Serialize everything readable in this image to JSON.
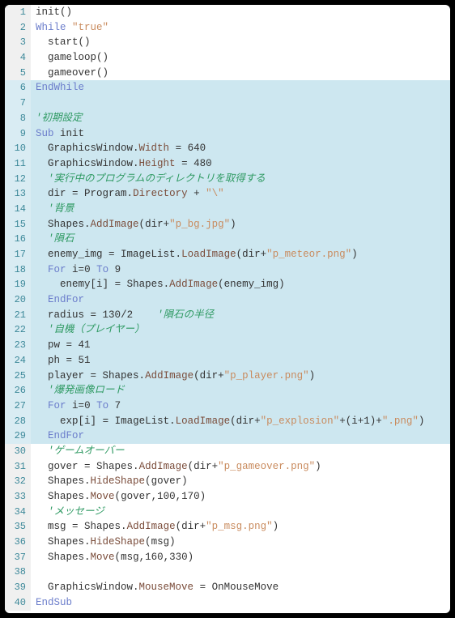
{
  "editor": {
    "colors": {
      "background": "#ffffff",
      "selection": "#cde7f0",
      "gutter_bg": "#f0f0f0",
      "gutter_fg": "#3c8899",
      "keyword": "#6b7dcb",
      "string": "#c98b5e",
      "comment": "#2f9a63",
      "member": "#7a4c3a",
      "default": "#333333"
    },
    "selection_range": [
      6,
      29
    ],
    "lines": [
      {
        "n": 1,
        "tokens": [
          [
            "ident",
            "init"
          ],
          [
            "punct",
            "()"
          ]
        ]
      },
      {
        "n": 2,
        "tokens": [
          [
            "keyword",
            "While"
          ],
          [
            "ident",
            " "
          ],
          [
            "string",
            "\"true\""
          ]
        ]
      },
      {
        "n": 3,
        "tokens": [
          [
            "ident",
            "  start"
          ],
          [
            "punct",
            "()"
          ]
        ]
      },
      {
        "n": 4,
        "tokens": [
          [
            "ident",
            "  gameloop"
          ],
          [
            "punct",
            "()"
          ]
        ]
      },
      {
        "n": 5,
        "tokens": [
          [
            "ident",
            "  gameover"
          ],
          [
            "punct",
            "()"
          ]
        ]
      },
      {
        "n": 6,
        "tokens": [
          [
            "keyword",
            "EndWhile"
          ]
        ]
      },
      {
        "n": 7,
        "tokens": []
      },
      {
        "n": 8,
        "tokens": [
          [
            "comment",
            "'初期設定"
          ]
        ]
      },
      {
        "n": 9,
        "tokens": [
          [
            "keyword",
            "Sub"
          ],
          [
            "ident",
            " init"
          ]
        ]
      },
      {
        "n": 10,
        "tokens": [
          [
            "ident",
            "  GraphicsWindow"
          ],
          [
            "punct",
            "."
          ],
          [
            "member",
            "Width"
          ],
          [
            "op",
            " = "
          ],
          [
            "number",
            "640"
          ]
        ]
      },
      {
        "n": 11,
        "tokens": [
          [
            "ident",
            "  GraphicsWindow"
          ],
          [
            "punct",
            "."
          ],
          [
            "member",
            "Height"
          ],
          [
            "op",
            " = "
          ],
          [
            "number",
            "480"
          ]
        ]
      },
      {
        "n": 12,
        "tokens": [
          [
            "ident",
            "  "
          ],
          [
            "comment",
            "'実行中のプログラムのディレクトリを取得する"
          ]
        ]
      },
      {
        "n": 13,
        "tokens": [
          [
            "ident",
            "  dir "
          ],
          [
            "op",
            "="
          ],
          [
            "ident",
            " Program"
          ],
          [
            "punct",
            "."
          ],
          [
            "member",
            "Directory"
          ],
          [
            "op",
            " + "
          ],
          [
            "string",
            "\"\\\""
          ]
        ]
      },
      {
        "n": 14,
        "tokens": [
          [
            "ident",
            "  "
          ],
          [
            "comment",
            "'背景"
          ]
        ]
      },
      {
        "n": 15,
        "tokens": [
          [
            "ident",
            "  Shapes"
          ],
          [
            "punct",
            "."
          ],
          [
            "member",
            "AddImage"
          ],
          [
            "punct",
            "("
          ],
          [
            "ident",
            "dir"
          ],
          [
            "op",
            "+"
          ],
          [
            "string",
            "\"p_bg.jpg\""
          ],
          [
            "punct",
            ")"
          ]
        ]
      },
      {
        "n": 16,
        "tokens": [
          [
            "ident",
            "  "
          ],
          [
            "comment",
            "'隕石"
          ]
        ]
      },
      {
        "n": 17,
        "tokens": [
          [
            "ident",
            "  enemy_img "
          ],
          [
            "op",
            "="
          ],
          [
            "ident",
            " ImageList"
          ],
          [
            "punct",
            "."
          ],
          [
            "member",
            "LoadImage"
          ],
          [
            "punct",
            "("
          ],
          [
            "ident",
            "dir"
          ],
          [
            "op",
            "+"
          ],
          [
            "string",
            "\"p_meteor.png\""
          ],
          [
            "punct",
            ")"
          ]
        ]
      },
      {
        "n": 18,
        "tokens": [
          [
            "ident",
            "  "
          ],
          [
            "keyword",
            "For"
          ],
          [
            "ident",
            " i"
          ],
          [
            "op",
            "="
          ],
          [
            "number",
            "0"
          ],
          [
            "ident",
            " "
          ],
          [
            "keyword",
            "To"
          ],
          [
            "ident",
            " "
          ],
          [
            "number",
            "9"
          ]
        ]
      },
      {
        "n": 19,
        "tokens": [
          [
            "ident",
            "    enemy"
          ],
          [
            "punct",
            "["
          ],
          [
            "ident",
            "i"
          ],
          [
            "punct",
            "]"
          ],
          [
            "op",
            " = "
          ],
          [
            "ident",
            "Shapes"
          ],
          [
            "punct",
            "."
          ],
          [
            "member",
            "AddImage"
          ],
          [
            "punct",
            "("
          ],
          [
            "ident",
            "enemy_img"
          ],
          [
            "punct",
            ")"
          ]
        ]
      },
      {
        "n": 20,
        "tokens": [
          [
            "ident",
            "  "
          ],
          [
            "keyword",
            "EndFor"
          ]
        ]
      },
      {
        "n": 21,
        "tokens": [
          [
            "ident",
            "  radius "
          ],
          [
            "op",
            "="
          ],
          [
            "ident",
            " "
          ],
          [
            "number",
            "130"
          ],
          [
            "op",
            "/"
          ],
          [
            "number",
            "2"
          ],
          [
            "ident",
            "    "
          ],
          [
            "comment",
            "'隕石の半径"
          ]
        ]
      },
      {
        "n": 22,
        "tokens": [
          [
            "ident",
            "  "
          ],
          [
            "comment",
            "'自機（プレイヤー）"
          ]
        ]
      },
      {
        "n": 23,
        "tokens": [
          [
            "ident",
            "  pw "
          ],
          [
            "op",
            "="
          ],
          [
            "ident",
            " "
          ],
          [
            "number",
            "41"
          ]
        ]
      },
      {
        "n": 24,
        "tokens": [
          [
            "ident",
            "  ph "
          ],
          [
            "op",
            "="
          ],
          [
            "ident",
            " "
          ],
          [
            "number",
            "51"
          ]
        ]
      },
      {
        "n": 25,
        "tokens": [
          [
            "ident",
            "  player "
          ],
          [
            "op",
            "="
          ],
          [
            "ident",
            " Shapes"
          ],
          [
            "punct",
            "."
          ],
          [
            "member",
            "AddImage"
          ],
          [
            "punct",
            "("
          ],
          [
            "ident",
            "dir"
          ],
          [
            "op",
            "+"
          ],
          [
            "string",
            "\"p_player.png\""
          ],
          [
            "punct",
            ")"
          ]
        ]
      },
      {
        "n": 26,
        "tokens": [
          [
            "ident",
            "  "
          ],
          [
            "comment",
            "'爆発画像ロード"
          ]
        ]
      },
      {
        "n": 27,
        "tokens": [
          [
            "ident",
            "  "
          ],
          [
            "keyword",
            "For"
          ],
          [
            "ident",
            " i"
          ],
          [
            "op",
            "="
          ],
          [
            "number",
            "0"
          ],
          [
            "ident",
            " "
          ],
          [
            "keyword",
            "To"
          ],
          [
            "ident",
            " "
          ],
          [
            "number",
            "7"
          ]
        ]
      },
      {
        "n": 28,
        "tokens": [
          [
            "ident",
            "    exp"
          ],
          [
            "punct",
            "["
          ],
          [
            "ident",
            "i"
          ],
          [
            "punct",
            "]"
          ],
          [
            "op",
            " = "
          ],
          [
            "ident",
            "ImageList"
          ],
          [
            "punct",
            "."
          ],
          [
            "member",
            "LoadImage"
          ],
          [
            "punct",
            "("
          ],
          [
            "ident",
            "dir"
          ],
          [
            "op",
            "+"
          ],
          [
            "string",
            "\"p_explosion\""
          ],
          [
            "op",
            "+"
          ],
          [
            "punct",
            "("
          ],
          [
            "ident",
            "i"
          ],
          [
            "op",
            "+"
          ],
          [
            "number",
            "1"
          ],
          [
            "punct",
            ")"
          ],
          [
            "op",
            "+"
          ],
          [
            "string",
            "\".png\""
          ],
          [
            "punct",
            ")"
          ]
        ]
      },
      {
        "n": 29,
        "tokens": [
          [
            "ident",
            "  "
          ],
          [
            "keyword",
            "EndFor"
          ]
        ]
      },
      {
        "n": 30,
        "tokens": [
          [
            "ident",
            "  "
          ],
          [
            "comment",
            "'ゲームオーバー"
          ]
        ]
      },
      {
        "n": 31,
        "tokens": [
          [
            "ident",
            "  gover "
          ],
          [
            "op",
            "="
          ],
          [
            "ident",
            " Shapes"
          ],
          [
            "punct",
            "."
          ],
          [
            "member",
            "AddImage"
          ],
          [
            "punct",
            "("
          ],
          [
            "ident",
            "dir"
          ],
          [
            "op",
            "+"
          ],
          [
            "string",
            "\"p_gameover.png\""
          ],
          [
            "punct",
            ")"
          ]
        ]
      },
      {
        "n": 32,
        "tokens": [
          [
            "ident",
            "  Shapes"
          ],
          [
            "punct",
            "."
          ],
          [
            "member",
            "HideShape"
          ],
          [
            "punct",
            "("
          ],
          [
            "ident",
            "gover"
          ],
          [
            "punct",
            ")"
          ]
        ]
      },
      {
        "n": 33,
        "tokens": [
          [
            "ident",
            "  Shapes"
          ],
          [
            "punct",
            "."
          ],
          [
            "member",
            "Move"
          ],
          [
            "punct",
            "("
          ],
          [
            "ident",
            "gover"
          ],
          [
            "punct",
            ","
          ],
          [
            "number",
            "100"
          ],
          [
            "punct",
            ","
          ],
          [
            "number",
            "170"
          ],
          [
            "punct",
            ")"
          ]
        ]
      },
      {
        "n": 34,
        "tokens": [
          [
            "ident",
            "  "
          ],
          [
            "comment",
            "'メッセージ"
          ]
        ]
      },
      {
        "n": 35,
        "tokens": [
          [
            "ident",
            "  msg "
          ],
          [
            "op",
            "="
          ],
          [
            "ident",
            " Shapes"
          ],
          [
            "punct",
            "."
          ],
          [
            "member",
            "AddImage"
          ],
          [
            "punct",
            "("
          ],
          [
            "ident",
            "dir"
          ],
          [
            "op",
            "+"
          ],
          [
            "string",
            "\"p_msg.png\""
          ],
          [
            "punct",
            ")"
          ]
        ]
      },
      {
        "n": 36,
        "tokens": [
          [
            "ident",
            "  Shapes"
          ],
          [
            "punct",
            "."
          ],
          [
            "member",
            "HideShape"
          ],
          [
            "punct",
            "("
          ],
          [
            "ident",
            "msg"
          ],
          [
            "punct",
            ")"
          ]
        ]
      },
      {
        "n": 37,
        "tokens": [
          [
            "ident",
            "  Shapes"
          ],
          [
            "punct",
            "."
          ],
          [
            "member",
            "Move"
          ],
          [
            "punct",
            "("
          ],
          [
            "ident",
            "msg"
          ],
          [
            "punct",
            ","
          ],
          [
            "number",
            "160"
          ],
          [
            "punct",
            ","
          ],
          [
            "number",
            "330"
          ],
          [
            "punct",
            ")"
          ]
        ]
      },
      {
        "n": 38,
        "tokens": []
      },
      {
        "n": 39,
        "tokens": [
          [
            "ident",
            "  GraphicsWindow"
          ],
          [
            "punct",
            "."
          ],
          [
            "member",
            "MouseMove"
          ],
          [
            "op",
            " = "
          ],
          [
            "ident",
            "OnMouseMove"
          ]
        ]
      },
      {
        "n": 40,
        "tokens": [
          [
            "keyword",
            "EndSub"
          ]
        ]
      }
    ]
  }
}
